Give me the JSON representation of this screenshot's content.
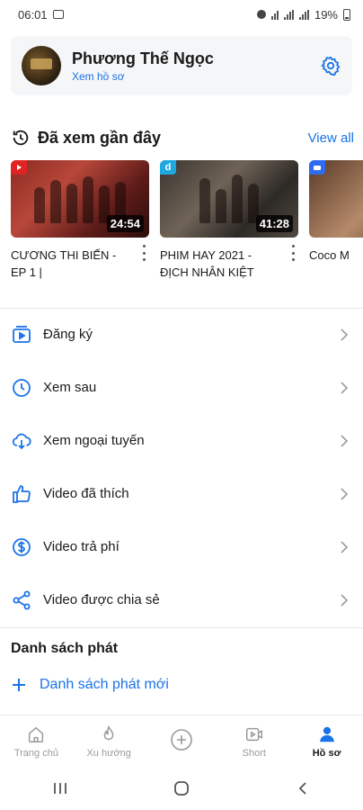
{
  "status_bar": {
    "time": "06:01",
    "battery": "19%"
  },
  "profile": {
    "name": "Phương Thế Ngọc",
    "link": "Xem hồ sơ"
  },
  "recent": {
    "title": "Đã xem gần đây",
    "view_all": "View all",
    "items": [
      {
        "title": "CƯƠNG THI BIẾN - EP 1 |",
        "duration": "24:54",
        "source": "youtube"
      },
      {
        "title": "PHIM HAY 2021 - ĐỊCH NHÂN KIỆT",
        "duration": "41:28",
        "source": "dailymotion",
        "badge": "d"
      },
      {
        "title": "Coco M",
        "duration": "",
        "source": "zoom"
      }
    ]
  },
  "menu": [
    {
      "label": "Đăng ký",
      "icon": "subscriptions-icon"
    },
    {
      "label": "Xem sau",
      "icon": "clock-icon"
    },
    {
      "label": "Xem ngoại tuyến",
      "icon": "download-cloud-icon"
    },
    {
      "label": "Video đã thích",
      "icon": "thumbs-up-icon"
    },
    {
      "label": "Video trả phí",
      "icon": "dollar-icon"
    },
    {
      "label": "Video được chia sẻ",
      "icon": "share-icon"
    }
  ],
  "playlist": {
    "title": "Danh sách phát",
    "new_label": "Danh sách phát mới"
  },
  "bottom_nav": [
    {
      "label": "Trang chủ",
      "icon": "home-icon"
    },
    {
      "label": "Xu hướng",
      "icon": "flame-icon"
    },
    {
      "label": "",
      "icon": "add-circle-icon"
    },
    {
      "label": "Short",
      "icon": "short-video-icon"
    },
    {
      "label": "Hồ sơ",
      "icon": "profile-icon",
      "active": true
    }
  ],
  "colors": {
    "accent": "#1a73e8",
    "text": "#1a1a1a",
    "inactive": "#9a9a9a"
  }
}
